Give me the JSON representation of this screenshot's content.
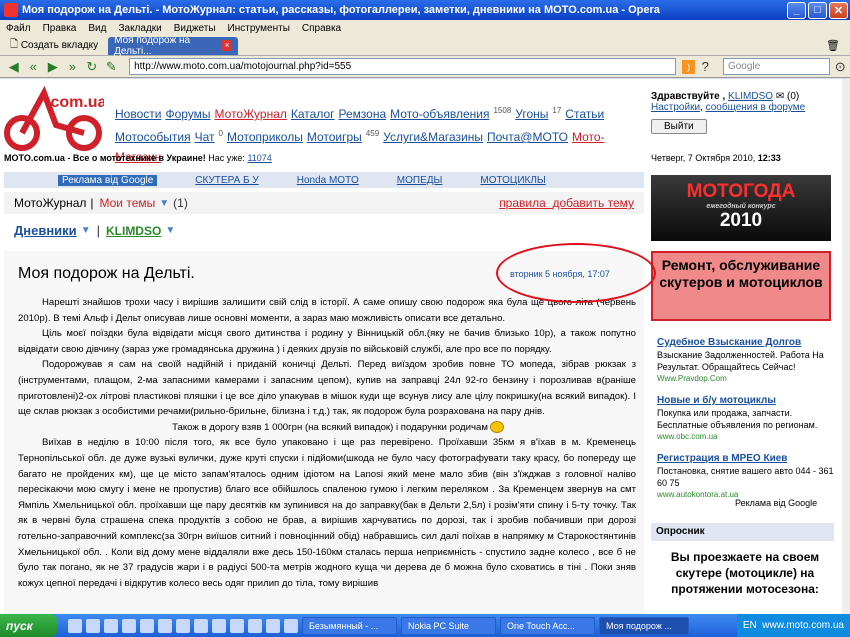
{
  "window": {
    "title": "Моя подорож на Дельті. - МотоЖурнал: статьи, рассказы, фотогаллереи, заметки, дневники на MOTO.com.ua - Opera"
  },
  "menu": [
    "Файл",
    "Правка",
    "Вид",
    "Закладки",
    "Виджеты",
    "Инструменты",
    "Справка"
  ],
  "tabs": {
    "new": "Создать вкладку",
    "active": "Моя подорож на Дельті..."
  },
  "address": {
    "url": "http://www.moto.com.ua/motojournal.php?id=555",
    "search": "Google"
  },
  "site": {
    "nav": {
      "items": [
        {
          "label": "Новости"
        },
        {
          "label": "Форумы"
        },
        {
          "label": "МотоЖурнал",
          "red": true
        },
        {
          "label": "Каталог"
        },
        {
          "label": "Ремзона"
        },
        {
          "label": "Мото-объявления",
          "sup": "1508"
        },
        {
          "label": "Угоны",
          "sup": "17"
        },
        {
          "label": "Статьи"
        },
        {
          "label": "Мотособытия"
        },
        {
          "label": "Чат",
          "sup": "0"
        },
        {
          "label": "Мотоприколы"
        },
        {
          "label": "Мотоигры",
          "sup": "459"
        },
        {
          "label": "Услуги&Магазины"
        },
        {
          "label": "Почта@МОТО"
        },
        {
          "label": "Мото-Магазин",
          "red": true
        }
      ]
    },
    "user": {
      "greet": "Здравствуйте ,",
      "name": "KLIMDSO",
      "mail": "(0)",
      "settings": "Настройки",
      "messages": "сообщения в форуме",
      "exit": "Выйти"
    },
    "slogan": {
      "text": "MOTO.com.ua - Все о мототехнике в Украине!",
      "count_label": "Нас уже:",
      "count": "11074"
    },
    "date": "Четверг, 7 Октября 2010,",
    "time": "12:33",
    "ribbon": {
      "ads": "Реклама від Google",
      "links": [
        "СКУТЕРА Б У",
        "Honda MOTO",
        "МОПЕДЫ",
        "МОТОЦИКЛЫ"
      ]
    },
    "journal": {
      "title": "МотоЖурнал",
      "sep": "|",
      "my": "Мои темы",
      "count": "(1)",
      "rules": "правила",
      "add": "добавить тему"
    },
    "diary": {
      "label": "Дневники",
      "sep": "|",
      "user": "KLIMDSO"
    },
    "article": {
      "title": "Моя подорож на Дельті.",
      "date": "вторник 5 ноября, 17:07",
      "paragraphs": [
        "Нарешті знайшов трохи часу і вирішив залишити свій слід в історії. А саме опишу свою подорож яка була ще цього літа (червень 2010р). В темі Альф і Дельт описував лише основні моменти, а зараз маю можливість описати все детально.",
        "Ціль моєї поїздки була відвідати місця свого дитинства і родину у Вінницькій обл.(яку не бачив близько 10р), а також попутно відвідати свою дівчину (зараз уже громадянська дружина ) і деяких друзів по військовій службі, але про все по порядку.",
        "Подорожував я сам на своїй надійній і приданій коничці Дельті. Перед виїздом зробив повне ТО мопеда, зібрав рюкзак з (інструментами, плащом, 2-ма запасними камерами і запасним цепом), купив на заправці 24л 92-го бензину і порозливав в(раніше приготовлені)2-ох літрові пластикові пляшки і це все діло упакував в мішок куди ще всунув лису але цілу покришку(на всякий випадок). І ще склав рюкзак з особистими речами(рильно-брильне, білизна і т.д.) так, як подорож була розрахована на пару днів.",
        "Також в дорогу взяв 1 000грн (на всякий випадок) і подарунки родичам",
        "Виїхав в неділю в 10:00 після того, як все було упаковано і ще раз перевірено. Проїхавши 35км я в'їхав в м. Кременець Тернопільської обл. де дуже вузькі вулички, дуже круті спуски і підйоми(шкода не було часу фотографувати таку красу, бо попереду ще багато не пройдених км), ще це місто запам'яталось одним ідіотом на Lanosi який мене мало збив (він з'їжджав з головної наліво пересікаючи мою смугу і мене не пропустив) благо все обійшлось спаленою гумою і легким переляком . За Кременцем звернув на смт Ямпіль Хмельницької обл. проїхавши ще пару десятків км зупинився на до заправку(бак в Дельти 2,5л) і розім'яти спину і 5-ту точку. Так як в червні була страшена спека продуктів з собою не брав, а вирішив харчуватись по дорозі, так і зробив побачивши при дорозі готельно-заправочний комплекс(за 30грн виїшов ситний і повноцінний обід) набравшись сил далі поїхав в напрямку м Старокостянтинів Хмельницької обл. . Коли від дому мене віддаляли вже десь 150-160км сталась перша неприємність - спустило задне колесо , все б не було так погано, як не 37 градусів жари і в радіусі 500-та метрів жодного куща чи дерева де б можна було сховатись в тіні . Поки зняв кожух цепної передачі і відкрутив колесо весь одяг прилип до тіла, тому вирішив"
      ]
    },
    "banners": {
      "b1": {
        "line1": "МОТОГОДА",
        "line2": "ежегодный конкурс",
        "line3": "2010"
      },
      "b2": {
        "text": "Ремонт, обслуживание скутеров и мотоциклов"
      }
    },
    "ads": [
      {
        "title": "Судебное Взыскание Долгов",
        "text": "Взыскание Задолженностей. Работа На Результат. Обращайтесь Сейчас!",
        "url": "Www.Pravdop.Com"
      },
      {
        "title": "Новые и б/у мотоциклы",
        "text": "Покупка или продажа, запчасти. Бесплатные объявления по регионам.",
        "url": "www.obc.com.ua"
      },
      {
        "title": "Регистрация в МРЕО Киев",
        "text": "Постановка, снятие вашего авто 044 - 361 60 75",
        "url": "www.autokontora.at.ua"
      }
    ],
    "ads_by": "Реклама від Google",
    "poll": {
      "title": "Опросник",
      "question": "Вы проезжаете на своем скутере (мотоцикле) на протяжении мотосезона:"
    }
  },
  "taskbar": {
    "start": "пуск",
    "tasks": [
      "Безымянный - ...",
      "Nokia PC Suite",
      "One Touch Acc...",
      "Моя подорож ..."
    ],
    "lang": "EN",
    "watermark": "www.moto.com.ua"
  }
}
